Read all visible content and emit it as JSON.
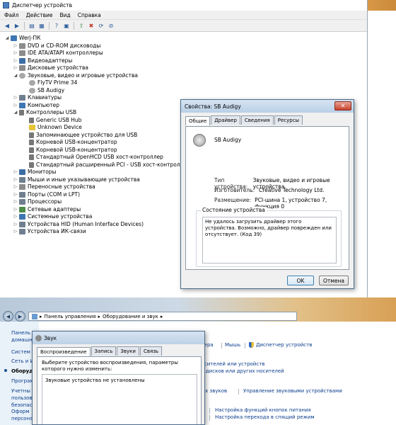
{
  "device_manager": {
    "title": "Диспетчер устройств",
    "menu": [
      "Файл",
      "Действие",
      "Вид",
      "Справка"
    ],
    "tree": [
      {
        "label": "Werj-ПК",
        "level": 0,
        "exp": "◢",
        "icon": "pc"
      },
      {
        "label": "DVD и CD-ROM дисководы",
        "level": 1,
        "exp": "▷",
        "icon": "disk"
      },
      {
        "label": "IDE ATA/ATAPI контроллеры",
        "level": 1,
        "exp": "▷",
        "icon": "disk"
      },
      {
        "label": "Видеоадаптеры",
        "level": 1,
        "exp": "▷",
        "icon": "mon"
      },
      {
        "label": "Дисковые устройства",
        "level": 1,
        "exp": "▷",
        "icon": "disk"
      },
      {
        "label": "Звуковые, видео и игровые устройства",
        "level": 1,
        "exp": "◢",
        "icon": "snd"
      },
      {
        "label": "FlyTV Prime 34",
        "level": 2,
        "exp": "",
        "icon": "snd"
      },
      {
        "label": "SB Audigy",
        "level": 2,
        "exp": "",
        "icon": "snd"
      },
      {
        "label": "Клавиатуры",
        "level": 1,
        "exp": "▷",
        "icon": "hid"
      },
      {
        "label": "Компьютер",
        "level": 1,
        "exp": "▷",
        "icon": "pc"
      },
      {
        "label": "Контроллеры USB",
        "level": 1,
        "exp": "◢",
        "icon": "usb"
      },
      {
        "label": "Generic USB Hub",
        "level": 2,
        "exp": "",
        "icon": "usb"
      },
      {
        "label": "Unknown Device",
        "level": 2,
        "exp": "",
        "icon": "warn"
      },
      {
        "label": "Запоминающее устройство для USB",
        "level": 2,
        "exp": "",
        "icon": "usb"
      },
      {
        "label": "Корневой USB-концентратор",
        "level": 2,
        "exp": "",
        "icon": "usb"
      },
      {
        "label": "Корневой USB-концентратор",
        "level": 2,
        "exp": "",
        "icon": "usb"
      },
      {
        "label": "Стандартный OpenHCD USB хост-контроллер",
        "level": 2,
        "exp": "",
        "icon": "usb"
      },
      {
        "label": "Стандартный расширенный PCI - USB хост-контроллер",
        "level": 2,
        "exp": "",
        "icon": "usb"
      },
      {
        "label": "Мониторы",
        "level": 1,
        "exp": "▷",
        "icon": "mon"
      },
      {
        "label": "Мыши и иные указывающие устройства",
        "level": 1,
        "exp": "▷",
        "icon": "hid"
      },
      {
        "label": "Переносные устройства",
        "level": 1,
        "exp": "▷",
        "icon": "disk"
      },
      {
        "label": "Порты (COM и LPT)",
        "level": 1,
        "exp": "▷",
        "icon": "hid"
      },
      {
        "label": "Процессоры",
        "level": 1,
        "exp": "▷",
        "icon": "hid"
      },
      {
        "label": "Сетевые адаптеры",
        "level": 1,
        "exp": "▷",
        "icon": "net"
      },
      {
        "label": "Системные устройства",
        "level": 1,
        "exp": "▷",
        "icon": "pc"
      },
      {
        "label": "Устройства HID (Human Interface Devices)",
        "level": 1,
        "exp": "▷",
        "icon": "hid"
      },
      {
        "label": "Устройства ИК-связи",
        "level": 1,
        "exp": "▷",
        "icon": "hid"
      }
    ]
  },
  "properties": {
    "title": "Свойства: SB Audigy",
    "close": "✕",
    "tabs": [
      "Общие",
      "Драйвер",
      "Сведения",
      "Ресурсы"
    ],
    "device_name": "SB Audigy",
    "rows": [
      {
        "key": "Тип устройства:",
        "value": "Звуковые, видео и игровые устройства"
      },
      {
        "key": "Изготовитель:",
        "value": "Creative Technology Ltd."
      },
      {
        "key": "Размещение:",
        "value": "PCI-шина 1, устройство 7, функция 0"
      }
    ],
    "status_legend": "Состояние устройства",
    "status_text": "Не удалось загрузить драйвер этого устройства. Возможно, драйвер поврежден или отсутствует. (Код 39)",
    "ok": "OK",
    "cancel": "Отмена"
  },
  "control_panel": {
    "breadcrumb": [
      "Панель управления",
      "Оборудование и звук"
    ],
    "left": [
      {
        "label": "Панель",
        "cur": false
      },
      {
        "label": "домашн",
        "cur": false
      },
      {
        "label": "Систем",
        "cur": false
      },
      {
        "label": "Сеть и И",
        "cur": false
      },
      {
        "label": "Оборуд",
        "cur": true
      },
      {
        "label": "Програм",
        "cur": false
      },
      {
        "label": "Учетны",
        "cur": false
      },
      {
        "label": "пользов",
        "cur": false
      },
      {
        "label": "безопас",
        "cur": false
      },
      {
        "label": "Оформ",
        "cur": false
      },
      {
        "label": "персона",
        "cur": false
      }
    ],
    "links": [
      "нтера",
      "Мышь",
      "Диспетчер устройств",
      "носителей или устройств",
      "кт-дисков или других носителей",
      "ных звуков",
      "Управление звуковыми устройствами",
      "Настройка функций кнопок питания",
      "Настройка перехода в спящий режим"
    ]
  },
  "sound": {
    "title": "Звук",
    "tabs": [
      "Воспроизведение",
      "Запись",
      "Звуки",
      "Связь"
    ],
    "desc": "Выберите устройство воспроизведения, параметры которого нужно изменить:",
    "empty": "Звуковые устройства не установлены"
  }
}
